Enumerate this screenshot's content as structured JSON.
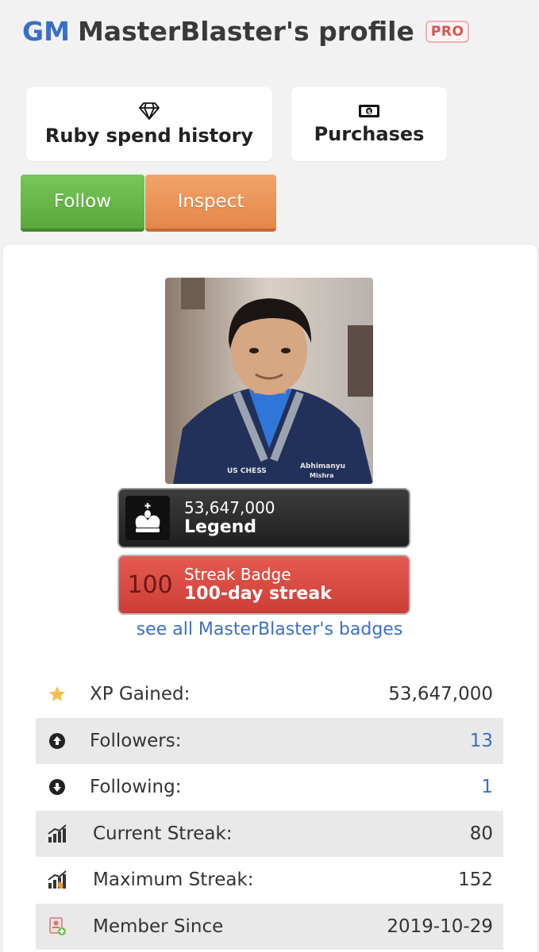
{
  "header": {
    "title_prefix": "GM",
    "title_name": "MasterBlaster's profile",
    "pro_badge": "PRO"
  },
  "buttons": {
    "ruby_label": "Ruby spend history",
    "ruby_icon": "diamond-icon",
    "purchases_label": "Purchases",
    "purchases_icon": "banknote-icon",
    "follow_label": "Follow",
    "inspect_label": "Inspect"
  },
  "badges": {
    "legend": {
      "value": "53,647,000",
      "title": "Legend",
      "icon": "king-icon"
    },
    "streak": {
      "number": "100",
      "label": "Streak Badge",
      "title": "100-day streak"
    }
  },
  "see_all_badges": "see all MasterBlaster's badges",
  "stats": [
    {
      "icon": "star-icon",
      "label": "XP Gained:",
      "value": "53,647,000"
    },
    {
      "icon": "arrow-up-circle-icon",
      "label": "Followers:",
      "value": "13"
    },
    {
      "icon": "arrow-down-circle-icon",
      "label": "Following:",
      "value": "1"
    },
    {
      "icon": "chart-icon",
      "label": "Current Streak:",
      "value": "80"
    },
    {
      "icon": "chart-fire-icon",
      "label": "Maximum Streak:",
      "value": "152"
    },
    {
      "icon": "member-icon",
      "label": "Member Since",
      "value": "2019-10-29"
    }
  ],
  "colors": {
    "link": "#3a6fc6",
    "follow": "#5aa83c",
    "inspect": "#e3864a",
    "streak_badge": "#cc3d35",
    "legend_badge": "#1f1f1f"
  }
}
